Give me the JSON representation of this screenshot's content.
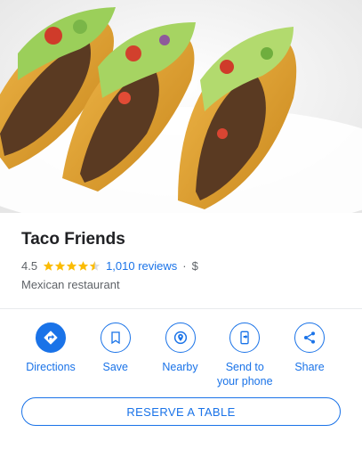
{
  "place": {
    "name": "Taco Friends",
    "rating": "4.5",
    "rating_value": 4.5,
    "reviews": "1,010 reviews",
    "separator": "·",
    "price": "$",
    "category": "Mexican restaurant"
  },
  "colors": {
    "accent": "#1a73e8",
    "star": "#fbbc04",
    "muted": "#5f6368"
  },
  "actions": [
    {
      "label": "Directions",
      "icon": "directions-icon"
    },
    {
      "label": "Save",
      "icon": "bookmark-icon"
    },
    {
      "label": "Nearby",
      "icon": "nearby-icon"
    },
    {
      "label": "Send to your phone",
      "icon": "send-to-phone-icon"
    },
    {
      "label": "Share",
      "icon": "share-icon"
    }
  ],
  "reserve": {
    "label": "RESERVE A TABLE"
  }
}
